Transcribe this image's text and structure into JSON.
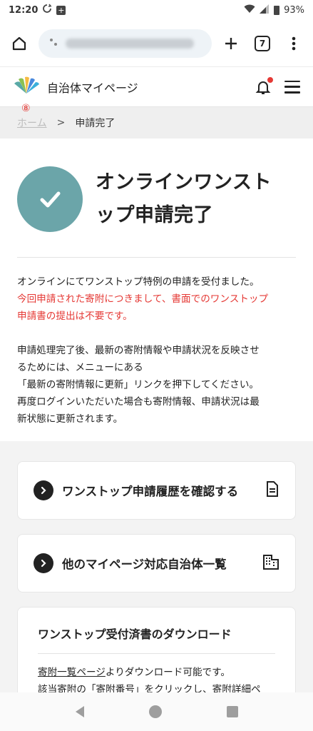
{
  "status_bar": {
    "time": "12:20",
    "battery": "93%",
    "icons": [
      "sync-icon",
      "notification-icon",
      "wifi-icon",
      "signal-icon",
      "battery-icon"
    ]
  },
  "browser": {
    "tab_count": "7",
    "icons": [
      "home-icon",
      "site-info-icon",
      "new-tab-icon",
      "tabs-icon",
      "more-vert-icon"
    ]
  },
  "header": {
    "site_title": "自治体マイページ",
    "icons": [
      "logo-icon",
      "bell-icon",
      "menu-icon"
    ]
  },
  "breadcrumb": {
    "badge": "⑧",
    "home": "ホーム",
    "separator": ">",
    "current": "申請完了"
  },
  "hero": {
    "title_line1": "オンラインワンスト",
    "title_line2": "ップ申請完了",
    "accent_color": "#6ba5a9"
  },
  "message": {
    "line1": "オンラインにてワンストップ特例の申請を受付ました。",
    "red_line1": "今回申請された寄附につきまして、書面でのワンストップ",
    "red_line2": "申請書の提出は不要です。",
    "p2_line1": "申請処理完了後、最新の寄附情報や申請状況を反映させ",
    "p2_line2": "るためには、メニューにある",
    "p2_line3": "「最新の寄附情報に更新」リンクを押下してください。",
    "p2_line4": "再度ログインいただいた場合も寄附情報、申請状況は最",
    "p2_line5": "新状態に更新されます。",
    "red_color": "#e53935"
  },
  "cards": {
    "history_label": "ワンストップ申請履歴を確認する",
    "others_label": "他のマイページ対応自治体一覧",
    "icons": [
      "chevron-right-icon",
      "document-icon",
      "building-icon"
    ]
  },
  "download": {
    "title": "ワンストップ受付済書のダウンロード",
    "link": "寄附一覧ページ",
    "text_rest": "よりダウンロード可能です。",
    "line2": "該当寄附の「寄附番号」をクリックし、寄附詳細ペ"
  }
}
